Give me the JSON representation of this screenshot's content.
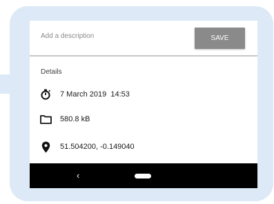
{
  "description": {
    "placeholder": "Add a description",
    "value": ""
  },
  "save_label": "SAVE",
  "details": {
    "section_label": "Details",
    "rows": [
      {
        "icon": "stopwatch-icon",
        "text": "7 March 2019  14:53"
      },
      {
        "icon": "folder-icon",
        "text": "580.8 kB"
      },
      {
        "icon": "location-pin-icon",
        "text": "51.504200, -0.149040"
      }
    ]
  },
  "nav_bar": {
    "back_icon": "chevron-left-icon",
    "back_glyph": "‹",
    "home_icon": "home-pill-icon"
  },
  "colors": {
    "callout_background": "#dde9f6",
    "save_button": "#8a8a8a",
    "nav_bar": "#000000"
  }
}
